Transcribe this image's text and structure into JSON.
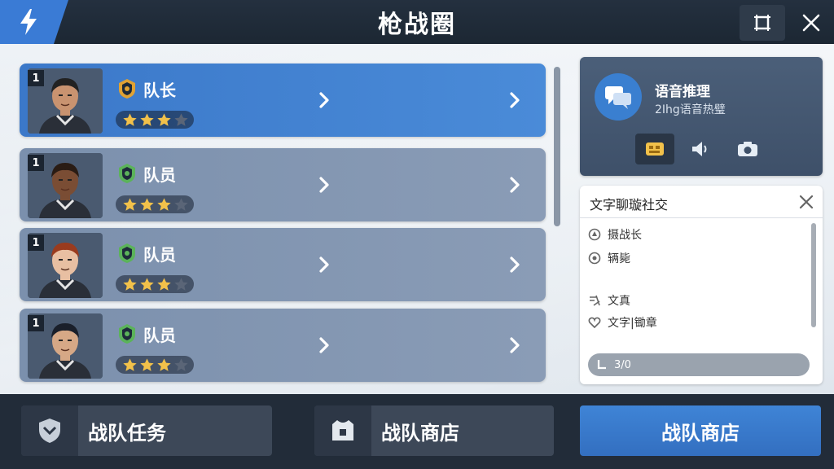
{
  "header": {
    "title": "枪战圈",
    "bolt_icon": "bolt-icon",
    "fullscreen_icon": "fullscreen-icon",
    "close_icon": "close-icon"
  },
  "members": [
    {
      "level": "1",
      "role": "队长",
      "role_color": "#e0a233",
      "stars": 3,
      "max_stars": 4,
      "active": true
    },
    {
      "level": "1",
      "role": "队员",
      "role_color": "#5bb35a",
      "stars": 3,
      "max_stars": 4,
      "active": false
    },
    {
      "level": "1",
      "role": "队员",
      "role_color": "#5bb35a",
      "stars": 3,
      "max_stars": 4,
      "active": false
    },
    {
      "level": "1",
      "role": "队员",
      "role_color": "#5bb35a",
      "stars": 3,
      "max_stars": 4,
      "active": false
    }
  ],
  "voice_panel": {
    "title": "语音推理",
    "subtitle": "2Ihg语音热璧"
  },
  "chat_panel": {
    "title": "文字聊璇社交",
    "lines": [
      {
        "icon": "pin-icon",
        "text": "摄战长"
      },
      {
        "icon": "target-icon",
        "text": "辆毙"
      },
      {
        "icon": "note-icon",
        "text": "文真"
      },
      {
        "icon": "heart-icon",
        "text": "文字|锄章"
      }
    ],
    "input_text": "3/0"
  },
  "bottom_bar": {
    "tasks_label": "战队任务",
    "shop_label": "战队商店",
    "primary_label": "战队商店"
  },
  "colors": {
    "accent": "#3a7bd5",
    "active_row": "#3b78c9",
    "inactive_row": "#7b90ad",
    "star_gold": "#f2c14a"
  }
}
